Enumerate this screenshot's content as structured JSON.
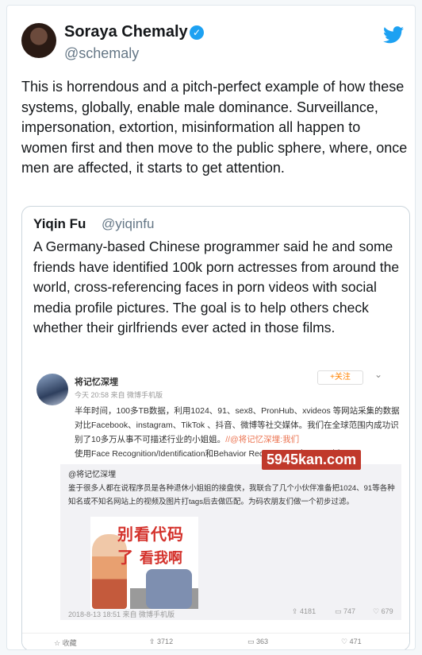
{
  "tweet": {
    "author_name": "Soraya Chemaly",
    "author_handle": "@schemaly",
    "verified_icon": "verified-check-icon",
    "brand_icon": "twitter-bird-icon",
    "text": "This is horrendous and a pitch-perfect example of how these systems, globally, enable male dominance. Surveillance, impersonation, extortion, misinformation all happen to women first and then move to the public sphere, where, once men are affected, it starts to get attention.",
    "brand_color": "#1da1f2"
  },
  "quoted_tweet": {
    "author_name": "Yiqin Fu",
    "author_handle": "@yiqinfu",
    "text": "A Germany-based Chinese programmer said he and some friends have identified 100k porn actresses from around the world, cross-referencing faces in porn videos with social media profile pictures. The goal is to help others check whether their girlfriends ever acted in those films."
  },
  "weibo": {
    "user_name": "将记忆深埋",
    "follow_label": "+关注",
    "meta": "今天 20:58 来自 微博手机版",
    "body_text": "半年时间，100多TB数据，利用1024、91、sex8、PronHub、xvideos 等网站采集的数据对比Facebook、instagram、TikTok 、抖音、微博等社交媒体。我们在全球范围内成功识别了10多万从事不可描述行业的小姐姐。",
    "body_at": "//@将记忆深埋:我们",
    "body_text2": "使用Face Recognition/Identification和Behavior Recognition 对 Spider 抓",
    "repost": {
      "user": "@将记忆深埋",
      "text": "鉴于很多人都在说程序员是各种退休小姐姐的接盘侠，我联合了几个小伙伴准备把1024、91等各种知名或不知名网站上的视频及图片打tags后去做匹配。为码农朋友们做一个初步过滤。",
      "comic_line1": "别看代码了",
      "comic_line2": "看我啊",
      "date": "2018-8-13 18:51 来自 微博手机版",
      "reposts": "4181",
      "comments": "747",
      "likes": "679"
    },
    "actions": {
      "favorite": "收藏",
      "repost": "3712",
      "comment": "363",
      "like": "471"
    }
  },
  "watermark": "5945kan.com"
}
